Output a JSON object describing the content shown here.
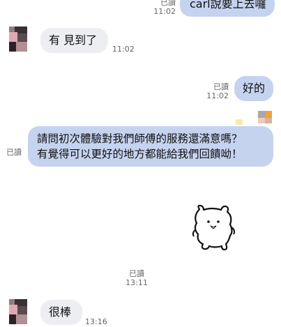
{
  "messages": {
    "m1": {
      "text": "carl說要上去囉",
      "read": "已讀",
      "time": "11:02"
    },
    "m2": {
      "text": "有 見到了",
      "time": "11:02"
    },
    "m3": {
      "text": "好的",
      "read": "已讀",
      "time": "11:02"
    },
    "m4": {
      "line1": "請問初次體驗對我們師傅的服務還滿意嗎？",
      "line2": "有覺得可以更好的地方都能給我們回饋呦！",
      "read": "已讀"
    },
    "m5": {
      "read": "已讀",
      "time": "13:11"
    },
    "m6": {
      "text": "很棒",
      "time": "13:16"
    }
  },
  "colors": {
    "outgoing_bubble": "#c5d3ef",
    "incoming_bubble": "#eceef1",
    "meta_text": "#666666"
  }
}
